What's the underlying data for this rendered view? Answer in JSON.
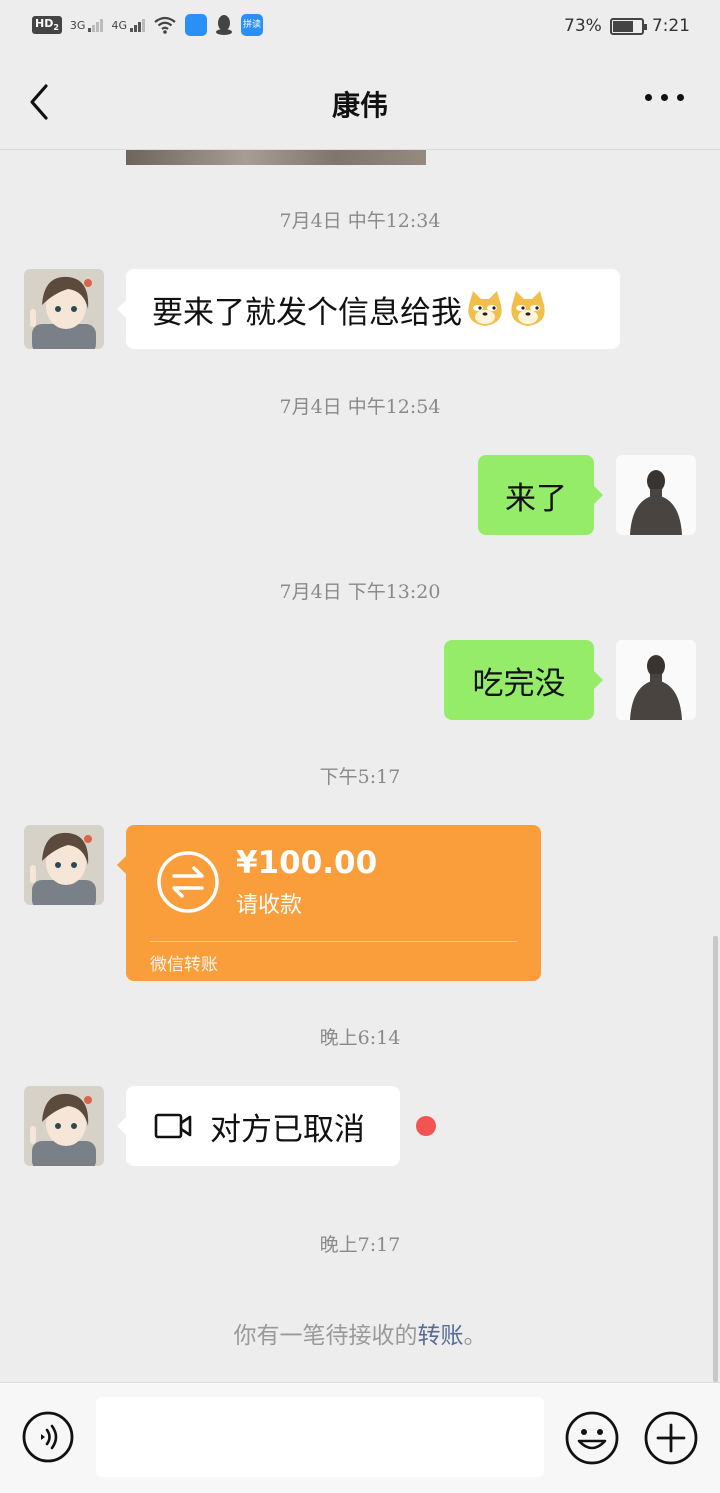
{
  "status_bar": {
    "hd": "HD",
    "hd_sub": "2",
    "net1": "3G",
    "net2": "4G",
    "app1_label": "",
    "app2_label": "拼读",
    "battery": "73%",
    "battery_level": 0.73,
    "time": "7:21"
  },
  "header": {
    "title": "康伟"
  },
  "messages": [
    {
      "timestamp": "7月4日 中午12:34",
      "from": "contact",
      "text": "要来了就发个信息给我"
    },
    {
      "timestamp": "7月4日 中午12:54",
      "from": "me",
      "text": "来了"
    },
    {
      "timestamp": "7月4日 下午13:20",
      "from": "me",
      "text": "吃完没"
    },
    {
      "timestamp": "下午5:17",
      "from": "contact",
      "type": "transfer"
    },
    {
      "timestamp": "晚上6:14",
      "from": "contact",
      "type": "video_call",
      "text": "对方已取消"
    },
    {
      "timestamp": "晚上7:17"
    }
  ],
  "transfer": {
    "amount": "¥100.00",
    "note": "请收款",
    "footer": "微信转账"
  },
  "system_message": {
    "prefix": "你有一笔待接收的",
    "link": "转账",
    "suffix": "。"
  },
  "input_bar": {
    "placeholder": ""
  },
  "colors": {
    "background": "#ededed",
    "my_bubble": "#95ec69",
    "transfer": "#fa9d3b",
    "link": "#576b95",
    "unread_dot": "#f25353"
  },
  "icons": [
    "back-icon",
    "more-icon",
    "video-call-icon",
    "transfer-icon",
    "voice-icon",
    "emoji-icon",
    "plus-icon"
  ]
}
